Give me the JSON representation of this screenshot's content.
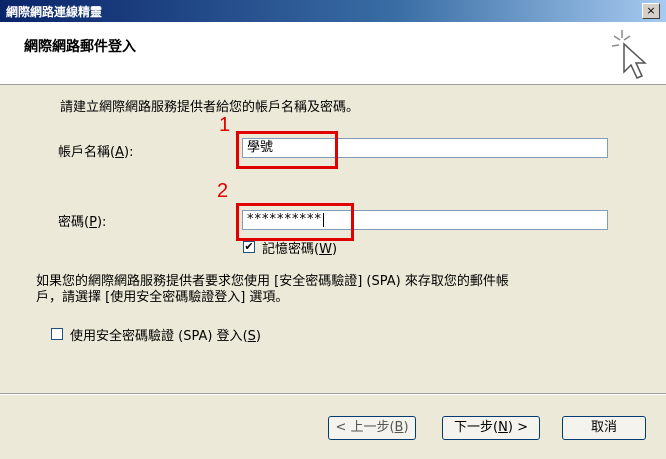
{
  "window": {
    "title": "網際網路連線精靈",
    "close_glyph": "×"
  },
  "header": {
    "title": "網際網路郵件登入"
  },
  "intro_text": "請建立網際網路服務提供者給您的帳戶名稱及密碼。",
  "account": {
    "label": "帳戶名稱",
    "accel": "A",
    "value": "學號"
  },
  "password": {
    "label": "密碼",
    "accel": "P",
    "value": "**********"
  },
  "remember": {
    "label": "記憶密碼",
    "accel": "W",
    "checked": true
  },
  "description": {
    "line1": "如果您的網際網路服務提供者要求您使用 [安全密碼驗證] (SPA) 來存取您的郵件帳",
    "line2": "戶，請選擇 [使用安全密碼驗證登入] 選項。"
  },
  "spa": {
    "label": "使用安全密碼驗證 (SPA) 登入",
    "accel": "S",
    "checked": false
  },
  "annotations": {
    "first": "1",
    "second": "2"
  },
  "buttons": {
    "back": {
      "prefix": "< 上一步",
      "accel": "B"
    },
    "next": {
      "prefix": "下一步",
      "accel": "N",
      "suffix": " >"
    },
    "cancel": "取消"
  },
  "colors": {
    "annotation": "#e00000",
    "title_bar": "#0a246a"
  },
  "icons": {
    "wizard": "cursor-sparkle-icon",
    "check": "check-icon"
  }
}
